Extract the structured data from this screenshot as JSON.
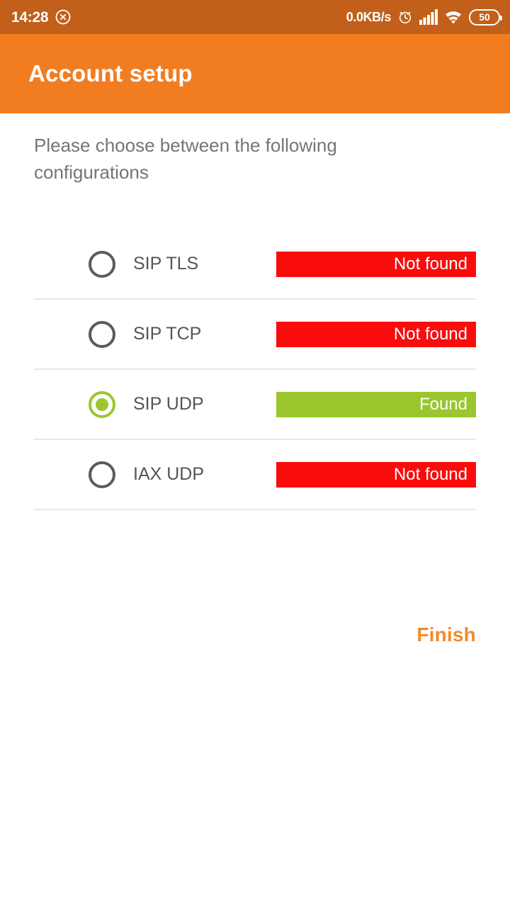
{
  "status_bar": {
    "time": "14:28",
    "dnd_icon": "circle-x-icon",
    "network_speed": "0.0KB/s",
    "alarm_icon": "alarm-clock-icon",
    "signal_icon": "cellular-signal-icon",
    "wifi_icon": "wifi-icon",
    "battery_level": "50",
    "background_color": "#c25f1b"
  },
  "app_bar": {
    "title": "Account setup",
    "background_color": "#f27d21"
  },
  "content": {
    "instructions": "Please choose between the following configurations",
    "options": [
      {
        "label": "SIP TLS",
        "status": "Not found",
        "selected": false,
        "status_color": "#fa0c0c"
      },
      {
        "label": "SIP TCP",
        "status": "Not found",
        "selected": false,
        "status_color": "#fa0c0c"
      },
      {
        "label": "SIP UDP",
        "status": "Found",
        "selected": true,
        "status_color": "#9bc62e"
      },
      {
        "label": "IAX UDP",
        "status": "Not found",
        "selected": false,
        "status_color": "#fa0c0c"
      }
    ]
  },
  "actions": {
    "finish_label": "Finish",
    "finish_color": "#f28b2a"
  }
}
